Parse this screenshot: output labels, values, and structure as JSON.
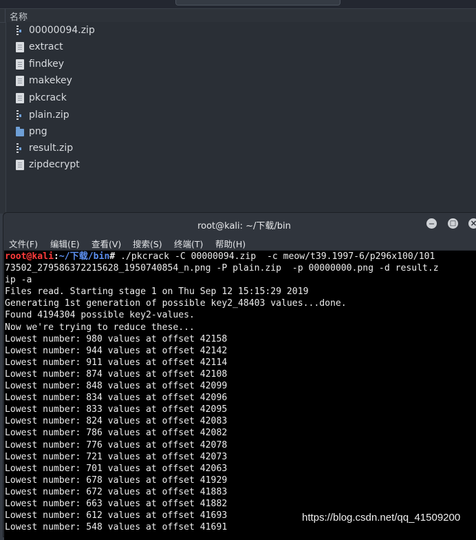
{
  "file_manager": {
    "column_header": "名称",
    "files": [
      {
        "name": "00000094.zip",
        "icon": "zip-file-icon"
      },
      {
        "name": "extract",
        "icon": "text-file-icon"
      },
      {
        "name": "findkey",
        "icon": "text-file-icon"
      },
      {
        "name": "makekey",
        "icon": "text-file-icon"
      },
      {
        "name": "pkcrack",
        "icon": "text-file-icon"
      },
      {
        "name": "plain.zip",
        "icon": "zip-file-icon"
      },
      {
        "name": "png",
        "icon": "folder-icon"
      },
      {
        "name": "result.zip",
        "icon": "zip-file-icon"
      },
      {
        "name": "zipdecrypt",
        "icon": "text-file-icon"
      }
    ]
  },
  "terminal": {
    "title": "root@kali: ~/下载/bin",
    "menu": [
      "文件(F)",
      "编辑(E)",
      "查看(V)",
      "搜索(S)",
      "终端(T)",
      "帮助(H)"
    ],
    "prompt": {
      "user": "root@kali",
      "sep": ":",
      "path": "~/下载/bin",
      "symbol": "#"
    },
    "command": " ./pkcrack -C 00000094.zip  -c meow/t39.1997-6/p296x100/101",
    "lines": [
      "73502_279586372215628_1950740854_n.png -P plain.zip  -p 00000000.png -d result.z",
      "ip -a",
      "Files read. Starting stage 1 on Thu Sep 12 15:15:29 2019",
      "Generating 1st generation of possible key2_48403 values...done.",
      "Found 4194304 possible key2-values.",
      "Now we're trying to reduce these...",
      "Lowest number: 980 values at offset 42158",
      "Lowest number: 944 values at offset 42142",
      "Lowest number: 911 values at offset 42114",
      "Lowest number: 874 values at offset 42108",
      "Lowest number: 848 values at offset 42099",
      "Lowest number: 834 values at offset 42096",
      "Lowest number: 833 values at offset 42095",
      "Lowest number: 824 values at offset 42083",
      "Lowest number: 786 values at offset 42082",
      "Lowest number: 776 values at offset 42078",
      "Lowest number: 721 values at offset 42073",
      "Lowest number: 701 values at offset 42063",
      "Lowest number: 678 values at offset 41929",
      "Lowest number: 672 values at offset 41883",
      "Lowest number: 663 values at offset 41882",
      "Lowest number: 612 values at offset 41693",
      "Lowest number: 548 values at offset 41691"
    ]
  },
  "watermark": "https://blog.csdn.net/qq_41509200",
  "colors": {
    "prompt_user": "#ff3b3b",
    "prompt_path": "#5c8ff0",
    "terminal_bg": "#000000"
  }
}
